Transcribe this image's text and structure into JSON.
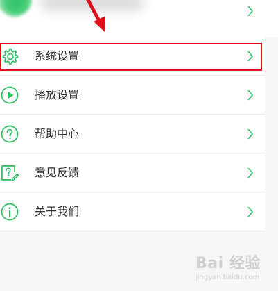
{
  "theme": {
    "accent": "#2dbe60",
    "highlight": "#e0101a",
    "text": "#333333",
    "chevron": "#2dbe60"
  },
  "menu": {
    "items": [
      {
        "label": "系统设置",
        "icon": "gear-icon"
      },
      {
        "label": "播放设置",
        "icon": "play-icon"
      },
      {
        "label": "帮助中心",
        "icon": "help-icon"
      },
      {
        "label": "意见反馈",
        "icon": "feedback-icon"
      },
      {
        "label": "关于我们",
        "icon": "info-icon"
      }
    ]
  },
  "watermark": {
    "logo": "Bai 经验",
    "url": "jingyan.baidu.com"
  }
}
